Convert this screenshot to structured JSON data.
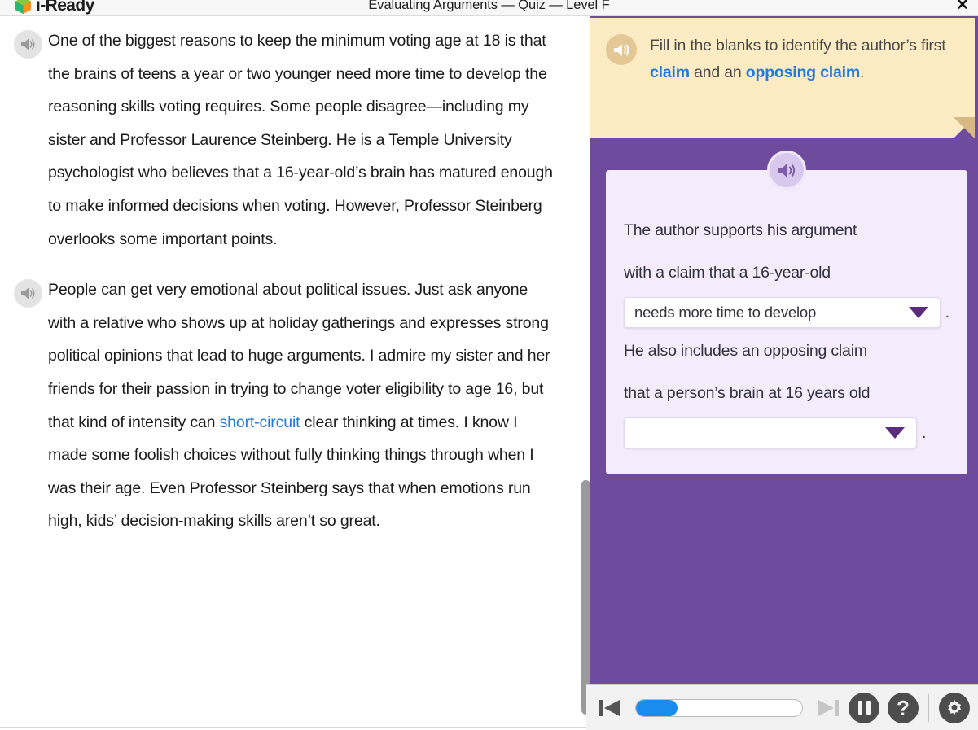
{
  "window": {
    "brand": "i-Ready",
    "title": "Evaluating Arguments — Quiz — Level F",
    "close_label": "✕"
  },
  "colors": {
    "panel_purple": "#6f4b9e",
    "instruction_cream": "#fdebc4",
    "card_lavender": "#f4ebfb",
    "link_blue": "#1f7ae0",
    "progress_blue": "#1a8cf0",
    "caret_purple": "#5b2b7e"
  },
  "reader": {
    "speaker_icon": "speaker-icon",
    "paragraphs": [
      {
        "id": "paragraph-1",
        "segments": [
          {
            "text": "One of the biggest reasons to keep the minimum voting age at 18 is that the brains of teens a year or two younger need more time to develop the reasoning skills voting requires. Some people disagree—including my sister and Professor Laurence Steinberg. He is a Temple University psychologist who believes that a 16-year-old’s brain has matured enough to make informed decisions when voting. However, Professor Steinberg overlooks some important points.",
            "style": "normal"
          }
        ]
      },
      {
        "id": "paragraph-2",
        "segments": [
          {
            "text": "People can get very emotional about political issues. Just ask anyone with a relative who shows up at holiday gatherings and expresses strong political opinions that lead to huge arguments. I admire my sister and her friends for their passion in trying to change voter eligibility to age 16, but that kind of intensity can ",
            "style": "normal"
          },
          {
            "text": "short-circuit",
            "style": "link"
          },
          {
            "text": " clear thinking at times. I know I made some foolish choices without fully thinking things through when I was their age. Even Professor Steinberg says that when emotions run high, kids’ decision-making skills aren’t so great.",
            "style": "normal"
          }
        ]
      }
    ]
  },
  "instruction": {
    "speaker_icon": "speaker-icon",
    "segments": [
      {
        "text": "Fill in the blanks to identify the author’s first ",
        "style": "normal"
      },
      {
        "text": "claim",
        "style": "term"
      },
      {
        "text": " and an ",
        "style": "normal"
      },
      {
        "text": "opposing claim",
        "style": "term"
      },
      {
        "text": ".",
        "style": "normal"
      }
    ]
  },
  "question": {
    "speaker_icon": "speaker-icon",
    "line1": "The author supports his argument",
    "line2": "with a claim that a 16-year-old",
    "line3": "He also includes an opposing claim",
    "line4": "that a person’s brain at 16 years old",
    "period": ".",
    "dropdown1": {
      "name": "first-claim-dropdown",
      "value": "needs more time to develop",
      "placeholder": ""
    },
    "dropdown2": {
      "name": "opposing-claim-dropdown",
      "value": "",
      "placeholder": ""
    }
  },
  "toolbar": {
    "back_label": "Previous",
    "next_label": "Next",
    "pause_label": "Pause",
    "help_label": "?",
    "settings_label": "Settings",
    "progress_percent": 25,
    "next_disabled": true
  }
}
